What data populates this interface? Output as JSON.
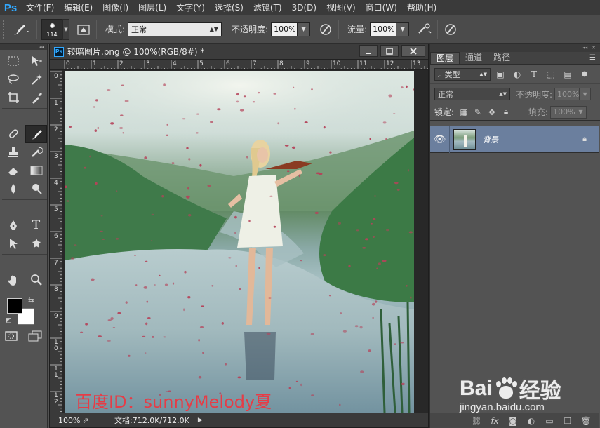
{
  "app": {
    "logo": "Ps"
  },
  "menu": [
    "文件(F)",
    "编辑(E)",
    "图像(I)",
    "图层(L)",
    "文字(Y)",
    "选择(S)",
    "滤镜(T)",
    "3D(D)",
    "视图(V)",
    "窗口(W)",
    "帮助(H)"
  ],
  "options": {
    "brush_size": "114",
    "mode_label": "模式:",
    "mode_value": "正常",
    "opacity_label": "不透明度:",
    "opacity_value": "100%",
    "flow_label": "流量:",
    "flow_value": "100%"
  },
  "document": {
    "title": "较暗图片.png @ 100%(RGB/8#) *",
    "ruler_top": [
      "0",
      "1",
      "2",
      "3",
      "4",
      "5",
      "6",
      "7",
      "8",
      "9",
      "10",
      "11",
      "12",
      "13"
    ],
    "ruler_left": [
      "0",
      "1",
      "2",
      "3",
      "4",
      "5",
      "6",
      "7",
      "8",
      "9",
      "1 0",
      "1 1",
      "1 2"
    ],
    "overlay_text": "百度ID：sunnyMelody夏",
    "zoom": "100%",
    "doc_info": "文档:712.0K/712.0K"
  },
  "layers_panel": {
    "tabs": [
      "图层",
      "通道",
      "路径"
    ],
    "filter_label": "类型",
    "blend_mode": "正常",
    "opacity_label": "不透明度:",
    "opacity_value": "100%",
    "lock_label": "锁定:",
    "fill_label": "填充:",
    "fill_value": "100%",
    "layer_name": "背景"
  },
  "watermark": {
    "brand_left": "Bai",
    "brand_right": "经验",
    "url": "jingyan.baidu.com"
  }
}
